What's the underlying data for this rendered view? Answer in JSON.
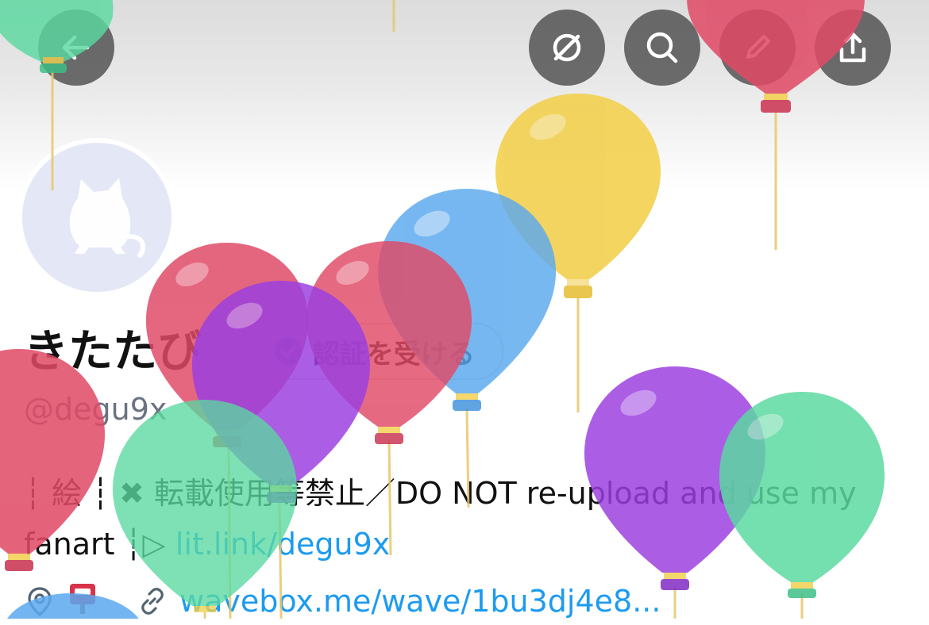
{
  "profile": {
    "display_name": "きたたび",
    "verify_button_label": "認証を受ける",
    "handle": "@degu9x",
    "bio_prefix": "┆ 絵 ┆ ✖ 転載使用等禁止／DO NOT re-upload and use my fanart ┆▷ ",
    "bio_link": "lit.link/degu9x",
    "location_pin_emoji": "📍",
    "mailbox_emoji": "📮",
    "website": "wavebox.me/wave/1bu3dj4e8..."
  },
  "header_actions": {
    "back": "arrow-left-icon",
    "mute": "no-sign-icon",
    "search": "search-icon",
    "edit": "pencil-icon",
    "share": "share-icon"
  },
  "balloon_colors": {
    "red": "#e04a66",
    "green": "#5ad9a0",
    "yellow": "#f2d04f",
    "blue": "#5aa8ee",
    "purple": "#9b3fe0"
  },
  "accent": "#1d9bf0"
}
